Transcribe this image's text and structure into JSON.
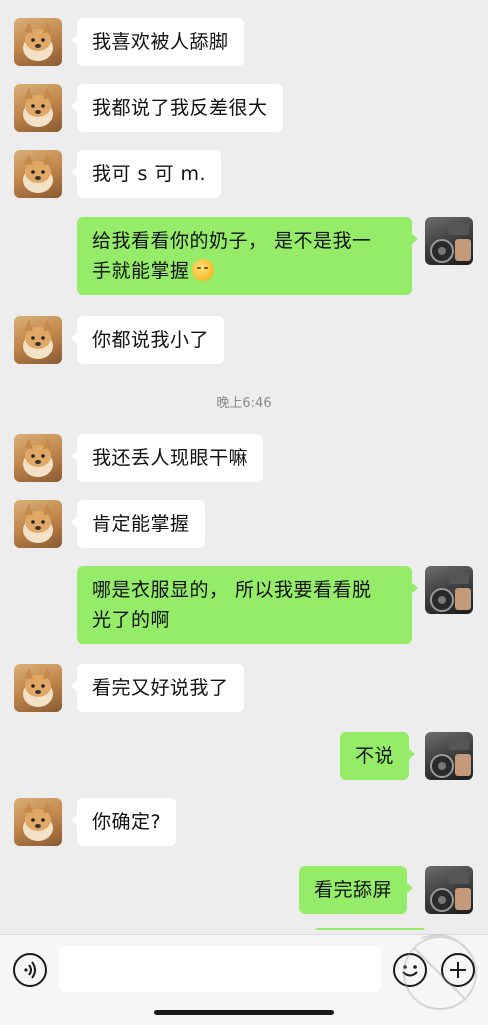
{
  "chat": {
    "messages": [
      {
        "side": "in",
        "text": "我喜欢被人舔脚"
      },
      {
        "side": "in",
        "text": "我都说了我反差很大"
      },
      {
        "side": "in",
        "text": "我可 s 可 m."
      },
      {
        "side": "out",
        "line1": "给我看看你的奶子，  是不是我一",
        "line2": "手就能掌握"
      },
      {
        "side": "in",
        "text": "你都说我小了"
      },
      {
        "timestamp": "晚上6:46"
      },
      {
        "side": "in",
        "text": "我还丢人现眼干嘛"
      },
      {
        "side": "in",
        "text": "肯定能掌握"
      },
      {
        "side": "out",
        "line1": "哪是衣服显的，  所以我要看看脱",
        "line2": "光了的啊"
      },
      {
        "side": "in",
        "text": "看完又好说我了"
      },
      {
        "side": "out",
        "text": "不说"
      },
      {
        "side": "in",
        "text": "你确定?"
      },
      {
        "side": "out",
        "text": "看完舔屏"
      }
    ]
  },
  "icons": {
    "voice": "voice-input-icon",
    "emoji": "emoji-icon",
    "more": "plus-icon",
    "inline_emoji": "hugging-face-emoji"
  },
  "colors": {
    "background": "#ededed",
    "incoming_bubble": "#ffffff",
    "outgoing_bubble": "#95ec69",
    "timestamp_text": "#8a8a8a"
  }
}
